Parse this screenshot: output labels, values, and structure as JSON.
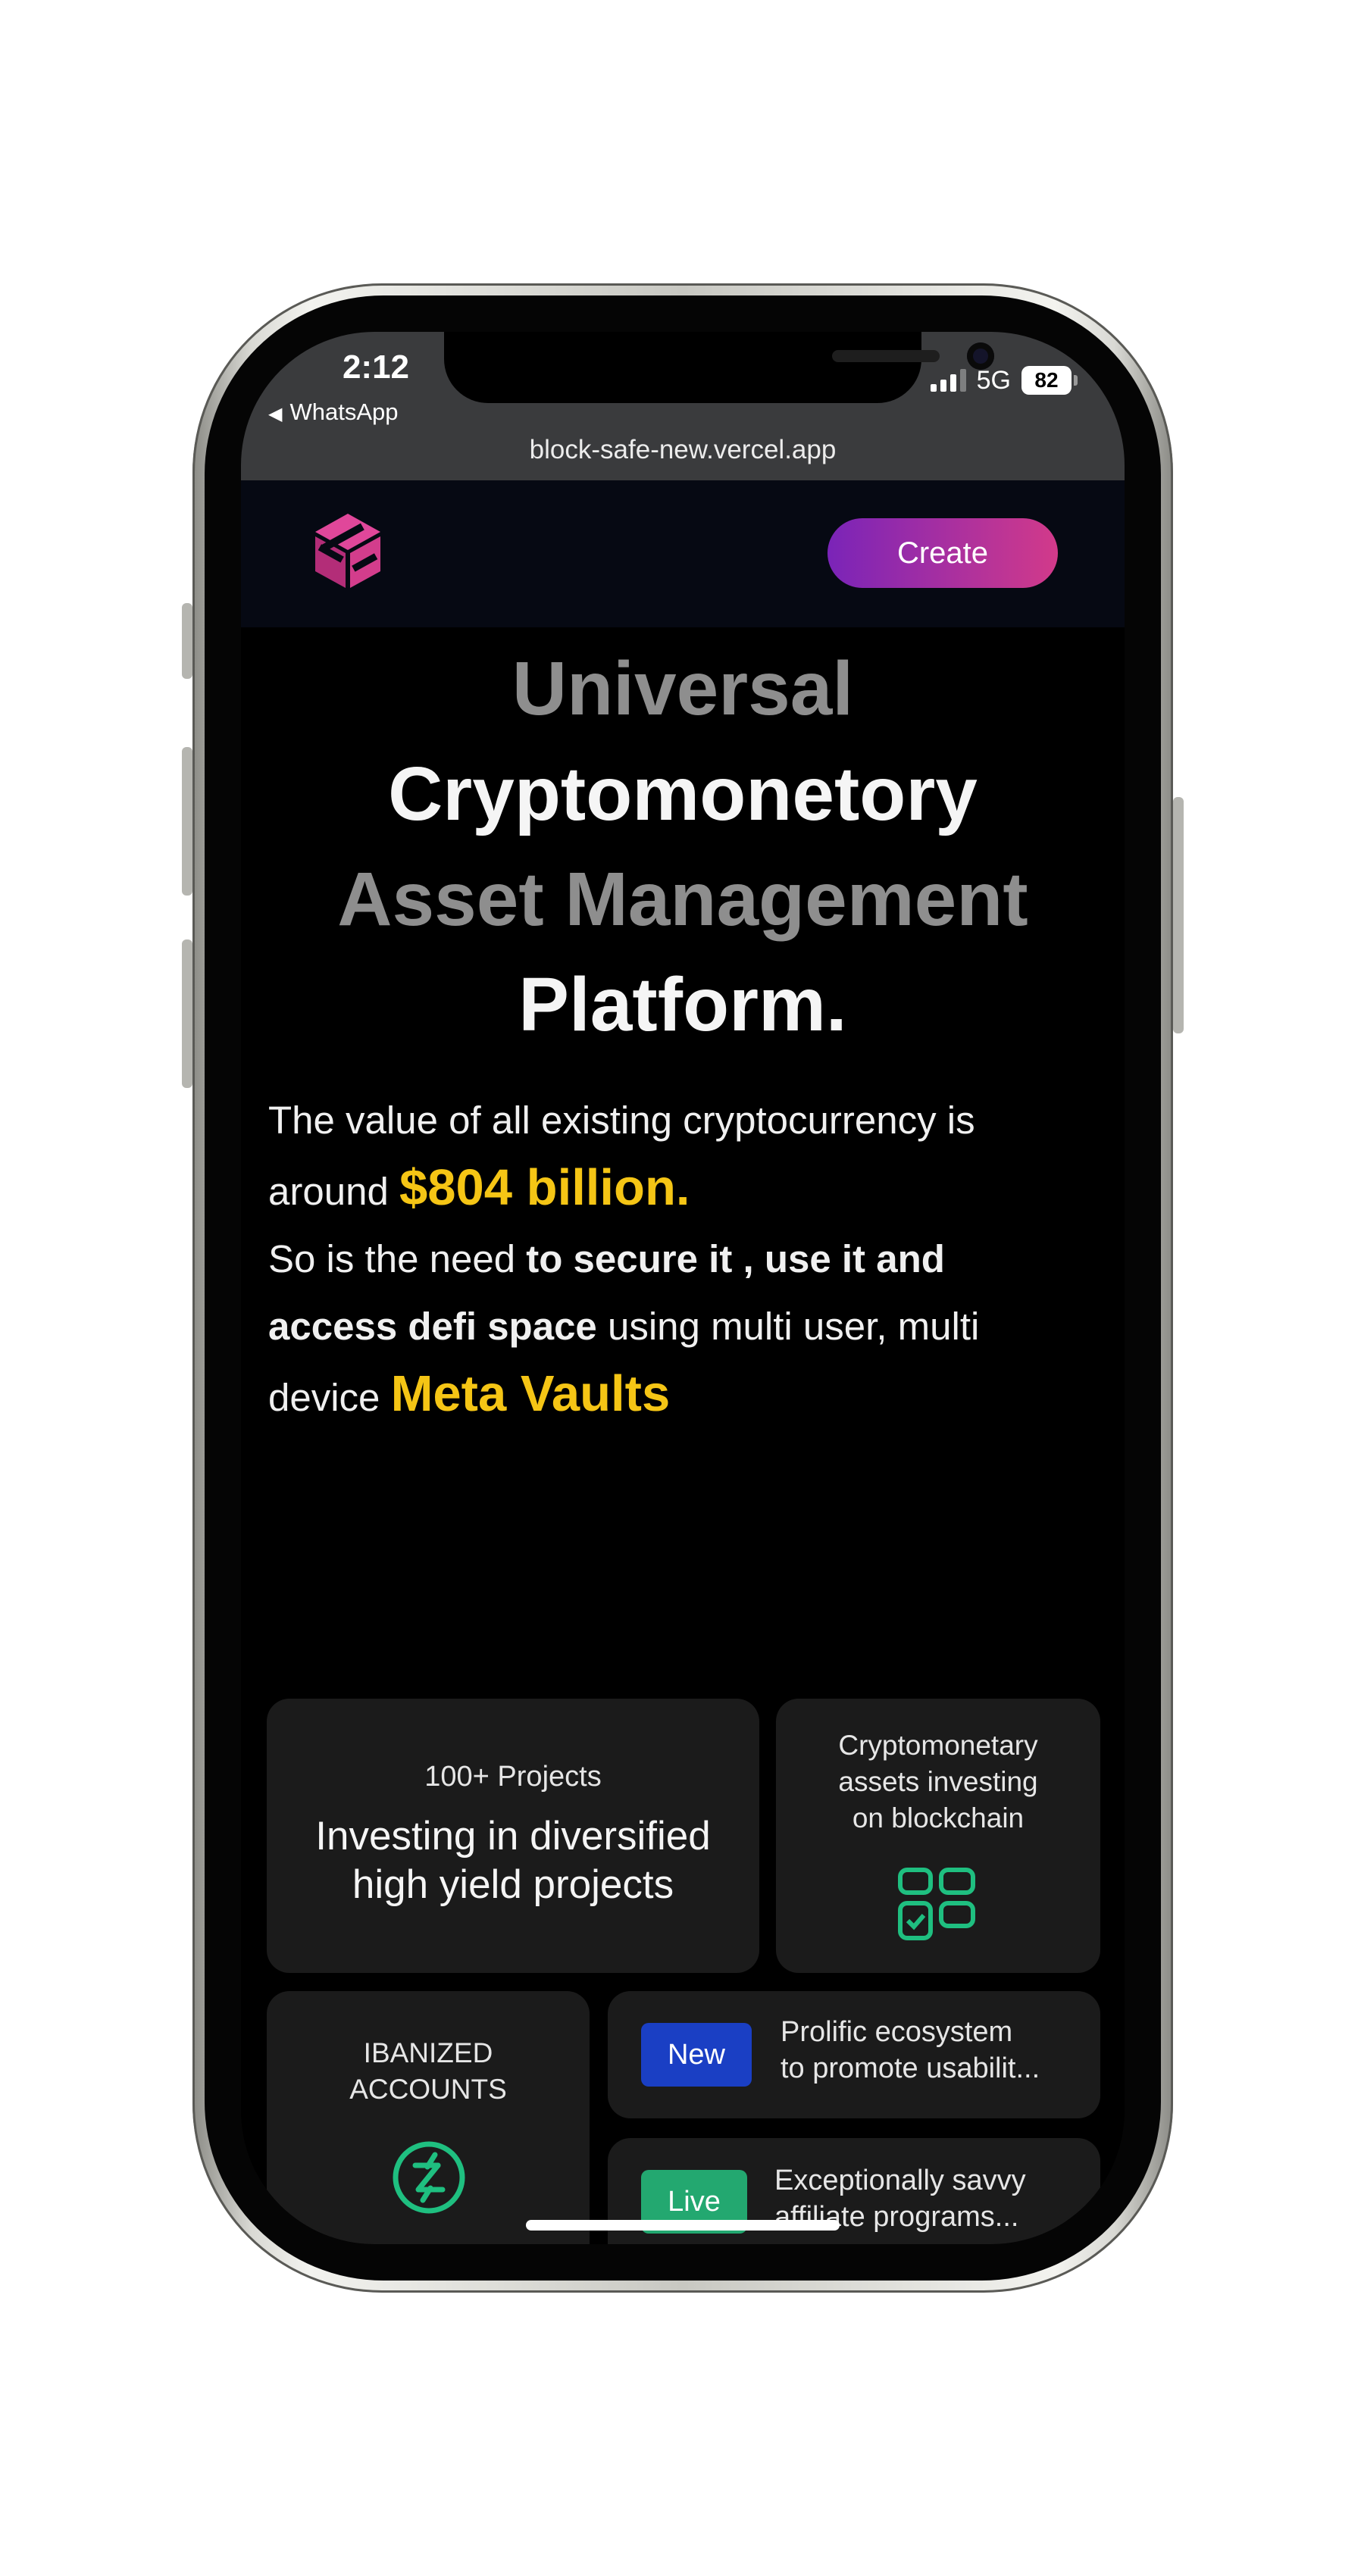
{
  "status_bar": {
    "time": "2:12",
    "back_app": "WhatsApp",
    "back_arrow": "◀",
    "network": "5G",
    "battery": "82"
  },
  "browser": {
    "url": "block-safe-new.vercel.app"
  },
  "header": {
    "create_label": "Create",
    "logo_icon": "blocksafe-logo-icon",
    "brand_color": "#d23a8a"
  },
  "hero": {
    "line1": "Universal",
    "line2": "Cryptomonetory",
    "line3": "Asset Management",
    "line4": "Platform.",
    "body": {
      "p1": "The value of all existing cryptocurrency is around",
      "p1_highlight": "$804 billion.",
      "p2_start": "So is the need",
      "p2_bold": "to secure it , use it and access defi space",
      "p2_end": "using multi user, multi device",
      "p2_highlight": "Meta Vaults"
    },
    "highlight_color": "#f5c515"
  },
  "cards": {
    "projects": {
      "small": "100+ Projects",
      "big_line1": "Investing in diversified",
      "big_line2": "high yield projects"
    },
    "crypto": {
      "line1": "Cryptomonetary",
      "line2": "assets investing",
      "line3": "on blockchain",
      "icon": "grid-check-icon"
    },
    "iban": {
      "line1": "IBANIZED",
      "line2": "ACCOUNTS",
      "icon": "z-circle-icon"
    },
    "ecosystem": {
      "badge": "New",
      "line1": "Prolific ecosystem",
      "line2": "to promote usabilit..."
    },
    "affiliate": {
      "badge": "Live",
      "line1": "Exceptionally savvy",
      "line2": "affiliate programs..."
    }
  }
}
